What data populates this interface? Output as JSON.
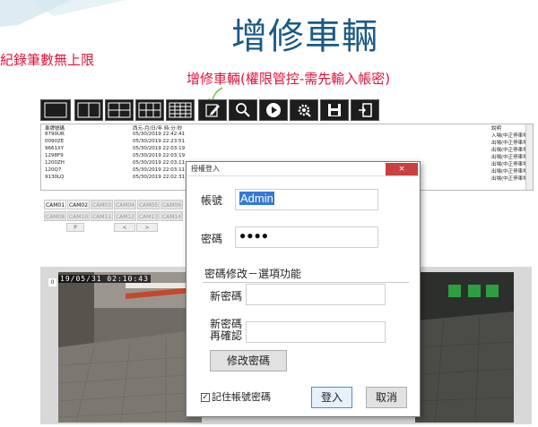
{
  "slide": {
    "title": "增修車輛",
    "left_note": "紀錄筆數無上限",
    "callout": "增修車輛(權限管控-需先輸入帳密)"
  },
  "toolbar": {
    "buttons": [
      {
        "name": "layout-1-icon"
      },
      {
        "name": "layout-4-icon"
      },
      {
        "name": "layout-6-icon"
      },
      {
        "name": "layout-9-icon"
      },
      {
        "name": "layout-16-icon"
      },
      {
        "name": "edit-vehicle-icon"
      },
      {
        "name": "search-icon"
      },
      {
        "name": "play-icon"
      },
      {
        "name": "settings-icon"
      },
      {
        "name": "save-icon"
      },
      {
        "name": "exit-icon"
      }
    ]
  },
  "log": {
    "headers": [
      "車牌號碼",
      "西元-月/日/年 時:分:秒",
      "說明"
    ],
    "rows": [
      [
        "8790UR",
        "05/30/2019 22:42:41",
        "入場(中正停車場)"
      ],
      [
        "0090ZE",
        "05/30/2019 22:23:51",
        "出場(中正停車場)"
      ],
      [
        "9661XY",
        "05/30/2019 22:03:19",
        "出場(中正停車場)"
      ],
      [
        "1298F9",
        "05/30/2019 22:03:19",
        "出場(中正停車場)"
      ],
      [
        "1200ZH",
        "05/30/2019 22:03:11",
        "出場(中正停車場)"
      ],
      [
        "120Q7",
        "05/30/2019 22:03:11",
        "出場(中正停車場)"
      ],
      [
        "9130LQ",
        "05/30/2019 22:02:31",
        "出場(中正停車場)"
      ]
    ]
  },
  "cams": {
    "row1": [
      "CAM01",
      "CAM02",
      "CAM03",
      "CAM04",
      "CAM05",
      "CAM06"
    ],
    "row2": [
      "CAM08",
      "CAM10",
      "CAM11",
      "CAM12",
      "CAM13",
      "CAM14"
    ],
    "active": [
      "CAM01",
      "CAM02"
    ],
    "p_label": "P",
    "prev_label": "<",
    "next_label": ">"
  },
  "video": {
    "channel": "0",
    "osd": "19/05/31  02:10:43"
  },
  "dialog": {
    "title": "授權登入",
    "close": "×",
    "account_label": "帳號",
    "account_value": "Admin",
    "password_label": "密碼",
    "password_value": "●●●●",
    "section_label": "密碼修改－選項功能",
    "new_password_label": "新密碼",
    "confirm_label_1": "新密碼",
    "confirm_label_2": "再確認",
    "change_button": "修改密碼",
    "remember_label": "記住帳號密碼",
    "remember_checked": "✓",
    "login_button": "登入",
    "cancel_button": "取消"
  },
  "colors": {
    "title": "#1a5a86",
    "note": "#e0143c",
    "toolbar": "#1d1d1d",
    "primary_border": "#4f8ad8"
  }
}
